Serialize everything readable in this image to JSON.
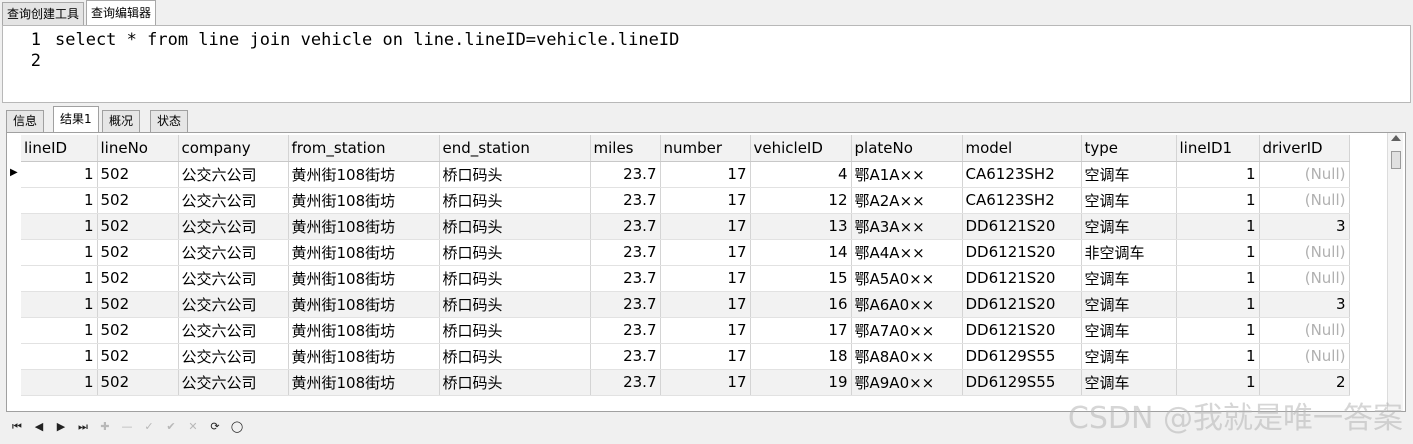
{
  "top_tabs": [
    "查询创建工具",
    "查询编辑器"
  ],
  "editor": {
    "lines": [
      "1",
      "2"
    ],
    "code": "select * from line join vehicle on line.lineID=vehicle.lineID"
  },
  "result_tabs": [
    "信息",
    "结果1",
    "概况",
    "状态"
  ],
  "grid": {
    "columns": [
      "lineID",
      "lineNo",
      "company",
      "from_station",
      "end_station",
      "miles",
      "number",
      "vehicleID",
      "plateNo",
      "model",
      "type",
      "lineID1",
      "driverID"
    ],
    "rows": [
      [
        "1",
        "502",
        "公交六公司",
        "黄州街108街坊",
        "桥口码头",
        "23.7",
        "17",
        "4",
        "鄂A1A××",
        "CA6123SH2",
        "空调车",
        "1",
        "(Null)"
      ],
      [
        "1",
        "502",
        "公交六公司",
        "黄州街108街坊",
        "桥口码头",
        "23.7",
        "17",
        "12",
        "鄂A2A××",
        "CA6123SH2",
        "空调车",
        "1",
        "(Null)"
      ],
      [
        "1",
        "502",
        "公交六公司",
        "黄州街108街坊",
        "桥口码头",
        "23.7",
        "17",
        "13",
        "鄂A3A××",
        "DD6121S20",
        "空调车",
        "1",
        "3"
      ],
      [
        "1",
        "502",
        "公交六公司",
        "黄州街108街坊",
        "桥口码头",
        "23.7",
        "17",
        "14",
        "鄂A4A××",
        "DD6121S20",
        "非空调车",
        "1",
        "(Null)"
      ],
      [
        "1",
        "502",
        "公交六公司",
        "黄州街108街坊",
        "桥口码头",
        "23.7",
        "17",
        "15",
        "鄂A5A0××",
        "DD6121S20",
        "空调车",
        "1",
        "(Null)"
      ],
      [
        "1",
        "502",
        "公交六公司",
        "黄州街108街坊",
        "桥口码头",
        "23.7",
        "17",
        "16",
        "鄂A6A0××",
        "DD6121S20",
        "空调车",
        "1",
        "3"
      ],
      [
        "1",
        "502",
        "公交六公司",
        "黄州街108街坊",
        "桥口码头",
        "23.7",
        "17",
        "17",
        "鄂A7A0××",
        "DD6121S20",
        "空调车",
        "1",
        "(Null)"
      ],
      [
        "1",
        "502",
        "公交六公司",
        "黄州街108街坊",
        "桥口码头",
        "23.7",
        "17",
        "18",
        "鄂A8A0××",
        "DD6129S55",
        "空调车",
        "1",
        "(Null)"
      ],
      [
        "1",
        "502",
        "公交六公司",
        "黄州街108街坊",
        "桥口码头",
        "23.7",
        "17",
        "19",
        "鄂A9A0××",
        "DD6129S55",
        "空调车",
        "1",
        "2"
      ]
    ]
  },
  "navbar": {
    "buttons": [
      "first-record",
      "prev-record",
      "next-record",
      "last-record",
      "add-record",
      "delete-record",
      "edit-record",
      "apply-record",
      "cancel-record",
      "refresh",
      "stop"
    ]
  },
  "watermark": "CSDN @我就是唯一答案"
}
